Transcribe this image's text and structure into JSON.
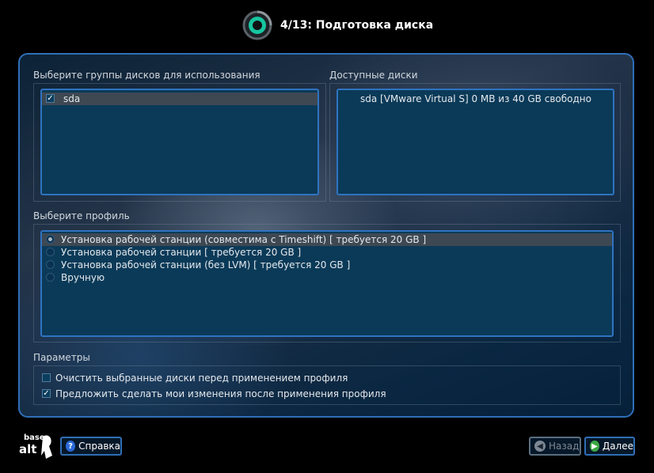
{
  "header": {
    "title": "4/13: Подготовка диска"
  },
  "disk_groups": {
    "label": "Выберите группы дисков для использования",
    "items": [
      {
        "label": "sda",
        "checked": true
      }
    ]
  },
  "available_disks": {
    "label": "Доступные диски",
    "items": [
      {
        "label": "sda [VMware Virtual S]  0 MB из 40 GB свободно"
      }
    ]
  },
  "profile": {
    "label": "Выберите профиль",
    "options": [
      {
        "label": "Установка рабочей станции (совместима с Timeshift) [ требуется 20 GB ]",
        "selected": true
      },
      {
        "label": "Установка рабочей станции [ требуется 20 GB ]",
        "selected": false
      },
      {
        "label": "Установка рабочей станции (без LVM) [ требуется 20 GB ]",
        "selected": false
      },
      {
        "label": "Вручную",
        "selected": false
      }
    ]
  },
  "params": {
    "label": "Параметры",
    "items": [
      {
        "label": "Очистить выбранные диски перед применением профиля",
        "checked": false
      },
      {
        "label": "Предложить сделать мои изменения после применения профиля",
        "checked": true
      }
    ]
  },
  "footer": {
    "logo_text_top": "base",
    "logo_text_bottom": "alt",
    "help_label": "Справка",
    "back_label": "Назад",
    "next_label": "Далее"
  },
  "colors": {
    "accent_border": "#2f73c0",
    "list_bg": "#0b3a58",
    "next_icon": "#3aa844",
    "help_icon": "#2a6ad8"
  }
}
